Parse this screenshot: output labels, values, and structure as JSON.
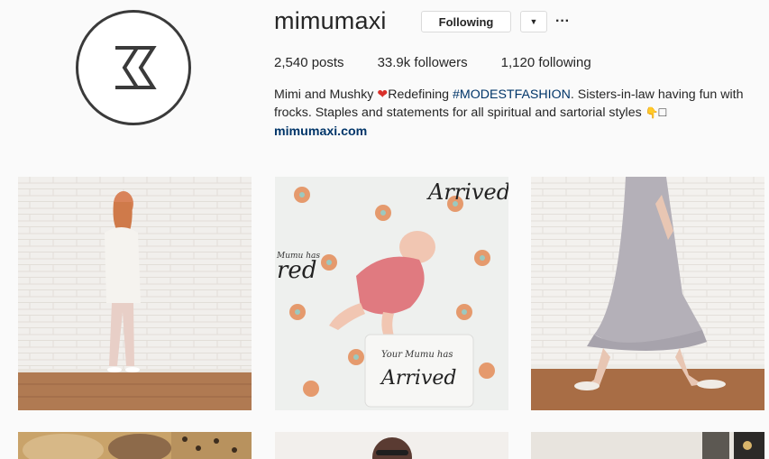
{
  "profile": {
    "username": "mimumaxi",
    "following_label": "Following",
    "dropdown_glyph": "▼",
    "more_glyph": "···",
    "stats": {
      "posts": "2,540 posts",
      "followers": "33.9k followers",
      "following": "1,120 following"
    },
    "bio": {
      "line1_before_heart": "Mimi and Mushky ",
      "heart": "❤",
      "line1_after_heart": "Redefining ",
      "hashtag": "#MODESTFASHION",
      "rest": ". Sisters-in-law having fun with frocks. Staples and statements for all spiritual and sartorial styles ",
      "hand": "👇",
      "box": "□"
    },
    "website": "mimumaxi.com"
  },
  "grid": {
    "posts": [
      {
        "name": "post-woman-white-blazer",
        "icon": "photo"
      },
      {
        "name": "post-baby-on-blanket",
        "icon": "photo"
      },
      {
        "name": "post-lavender-ruffle-dress",
        "icon": "photo"
      },
      {
        "name": "post-hats-and-leopard",
        "icon": "photo"
      },
      {
        "name": "post-woman-sunglasses",
        "icon": "photo"
      },
      {
        "name": "post-interior-mirror",
        "icon": "photo"
      }
    ],
    "baby_blanket_text": {
      "top": "Arrived",
      "left_word": "red",
      "pillow_small": "Your Mumu has",
      "pillow_big": "Arrived",
      "script_small": "Mumu has"
    }
  },
  "colors": {
    "link": "#003569",
    "border": "#dbdbdb"
  }
}
